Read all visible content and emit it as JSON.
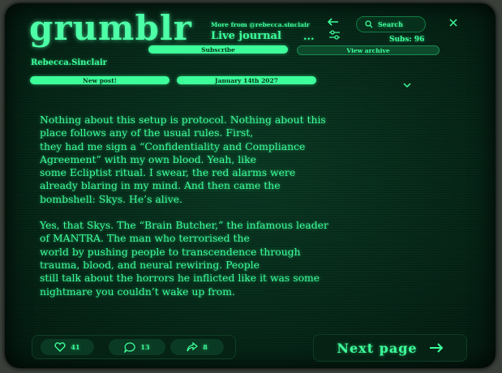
{
  "header": {
    "logo": "grumblr",
    "more_from": "More from @rebecca.sinclair",
    "journal_title": "Live journal",
    "more_menu": "...",
    "search_label": "Search",
    "subs": "Subs: 96",
    "subscribe_label": "Subscribe",
    "view_archive_label": "View archive"
  },
  "post": {
    "author": "Rebecca.Sinclair",
    "new_post_label": "New post!",
    "date": "January 14th 2027",
    "paragraphs": [
      "Nothing about this setup is protocol. Nothing about this\nplace follows any of the usual rules. First,\nthey had me sign a “Confidentiality and Compliance\nAgreement” with my own blood. Yeah, like\nsome Ecliptist ritual. I swear, the red alarms were\nalready blaring in my mind. And then came the\nbombshell: Skys. He’s alive.",
      "Yes, that Skys. The “Brain Butcher,” the infamous leader\nof MANTRA. The man who terrorised the\nworld by pushing people to transcendence through\ntrauma, blood, and neural rewiring. People\nstill talk about the horrors he inflicted like it was some\nnightmare you couldn’t wake up from."
    ]
  },
  "actions": {
    "likes": "41",
    "comments": "13",
    "shares": "8",
    "next_page_label": "Next page"
  },
  "icons": {
    "back": "arrow-left-icon",
    "filters": "sliders-icon",
    "search": "search-icon",
    "close": "close-icon",
    "expand": "chevron-down-icon",
    "like": "heart-icon",
    "comment": "comment-icon",
    "share": "share-icon",
    "next": "arrow-right-icon"
  },
  "colors": {
    "accent": "#3dff9a",
    "background": "#072a1a"
  }
}
